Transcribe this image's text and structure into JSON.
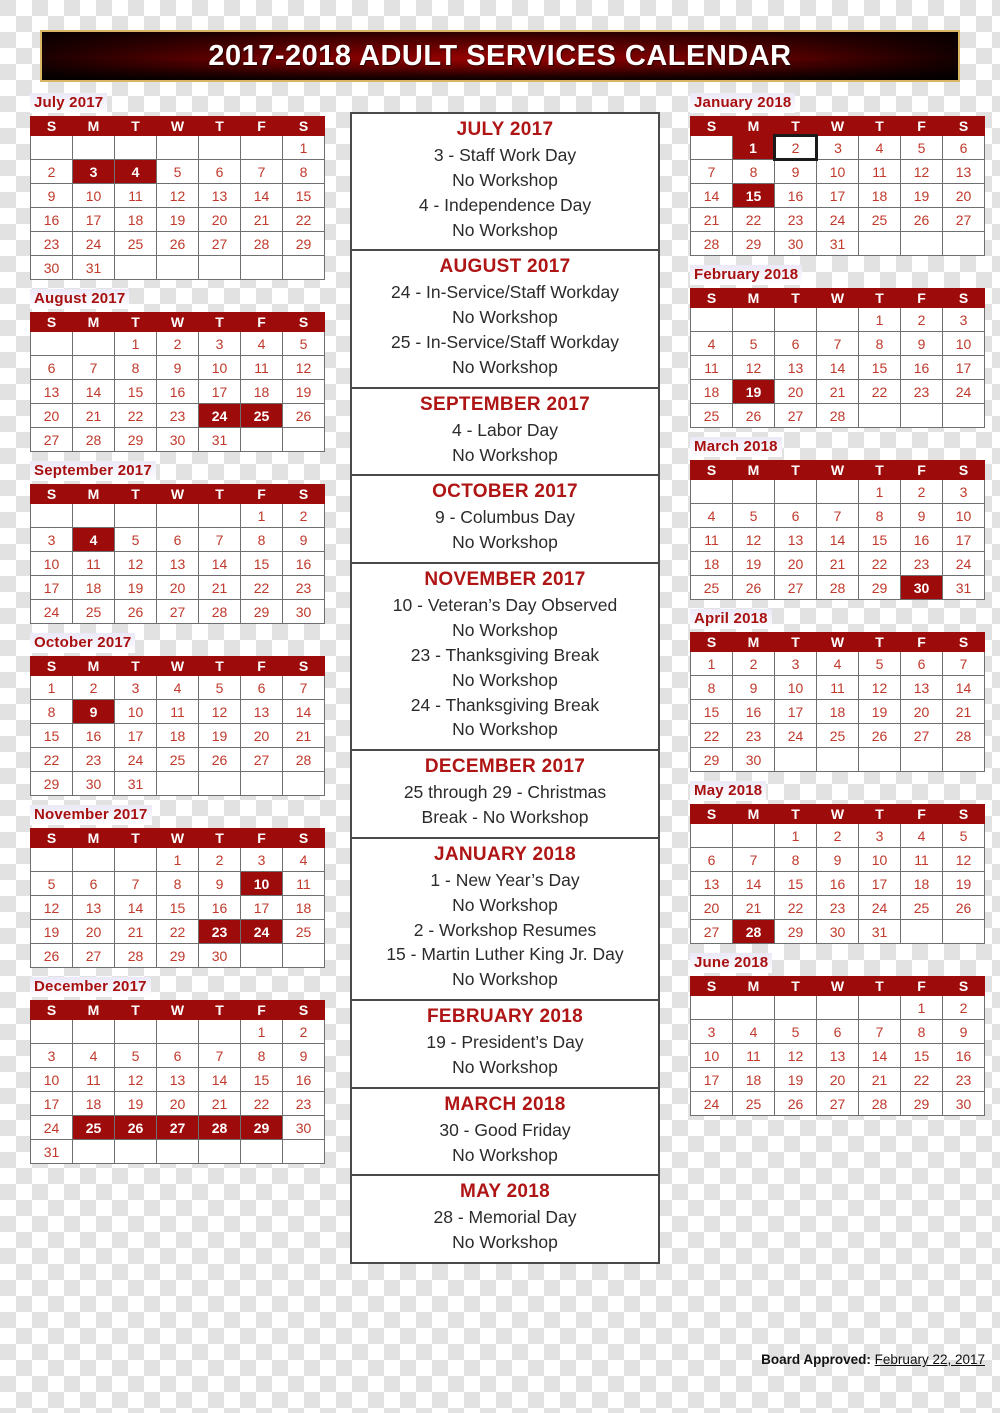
{
  "banner": {
    "title": "2017-2018 ADULT SERVICES CALENDAR"
  },
  "colors": {
    "header_red": "#9e0b0b",
    "day_text_red": "#c0392b",
    "month_label_red": "#a81010",
    "note_month_red": "#b01515",
    "highlight_bg": "#9e0b0b",
    "grid_line": "#6f6f6f",
    "banner_border_gold": "#d9b566"
  },
  "weekday_headers": [
    "S",
    "M",
    "T",
    "W",
    "T",
    "F",
    "S"
  ],
  "left_months": [
    {
      "label": "July 2017",
      "lead_blanks": 6,
      "days": 31,
      "highlight": [
        3,
        4
      ],
      "boxed": []
    },
    {
      "label": "August 2017",
      "lead_blanks": 2,
      "days": 31,
      "highlight": [
        24,
        25
      ],
      "boxed": []
    },
    {
      "label": "September 2017",
      "lead_blanks": 5,
      "days": 30,
      "highlight": [
        4
      ],
      "boxed": []
    },
    {
      "label": "October 2017",
      "lead_blanks": 0,
      "days": 31,
      "highlight": [
        9
      ],
      "boxed": []
    },
    {
      "label": "November 2017",
      "lead_blanks": 3,
      "days": 30,
      "highlight": [
        10,
        23,
        24
      ],
      "boxed": []
    },
    {
      "label": "December 2017",
      "lead_blanks": 5,
      "days": 31,
      "highlight": [
        25,
        26,
        27,
        28,
        29
      ],
      "boxed": []
    }
  ],
  "right_months": [
    {
      "label": "January 2018",
      "lead_blanks": 1,
      "days": 31,
      "highlight": [
        1,
        15
      ],
      "boxed": [
        2
      ]
    },
    {
      "label": "February 2018",
      "lead_blanks": 4,
      "days": 28,
      "highlight": [
        19
      ],
      "boxed": []
    },
    {
      "label": "March 2018",
      "lead_blanks": 4,
      "days": 31,
      "highlight": [
        30
      ],
      "boxed": []
    },
    {
      "label": "April 2018",
      "lead_blanks": 0,
      "days": 30,
      "highlight": [],
      "boxed": []
    },
    {
      "label": "May 2018",
      "lead_blanks": 2,
      "days": 31,
      "highlight": [
        28
      ],
      "boxed": []
    },
    {
      "label": "June 2018",
      "lead_blanks": 5,
      "days": 30,
      "highlight": [],
      "boxed": []
    }
  ],
  "notes": [
    {
      "month": "JULY 2017",
      "lines": [
        "3 - Staff Work Day",
        "No Workshop",
        "4 - Independence Day",
        "No Workshop"
      ]
    },
    {
      "month": "AUGUST 2017",
      "lines": [
        "24 - In-Service/Staff Workday",
        "No Workshop",
        "25 - In-Service/Staff Workday",
        "No Workshop"
      ]
    },
    {
      "month": "SEPTEMBER 2017",
      "lines": [
        "4 - Labor Day",
        "No Workshop"
      ]
    },
    {
      "month": "OCTOBER 2017",
      "lines": [
        "9 - Columbus Day",
        "No Workshop"
      ]
    },
    {
      "month": "NOVEMBER 2017",
      "lines": [
        "10 - Veteran’s Day Observed",
        "No Workshop",
        "23 - Thanksgiving Break",
        "No Workshop",
        "24 - Thanksgiving Break",
        "No Workshop"
      ]
    },
    {
      "month": "DECEMBER 2017",
      "lines": [
        "25 through 29 - Christmas",
        "Break - No Workshop"
      ]
    },
    {
      "month": "JANUARY 2018",
      "lines": [
        "1 - New Year’s Day",
        "No Workshop",
        "2 - Workshop Resumes",
        "15 - Martin Luther King Jr. Day",
        "No Workshop"
      ]
    },
    {
      "month": "FEBRUARY 2018",
      "lines": [
        "19 - President’s Day",
        "No Workshop"
      ]
    },
    {
      "month": "MARCH 2018",
      "lines": [
        "30 - Good Friday",
        "No Workshop"
      ]
    },
    {
      "month": "MAY 2018",
      "lines": [
        "28 - Memorial Day",
        "No Workshop"
      ]
    }
  ],
  "footer": {
    "label": "Board Approved:",
    "date": "February 22, 2017"
  }
}
